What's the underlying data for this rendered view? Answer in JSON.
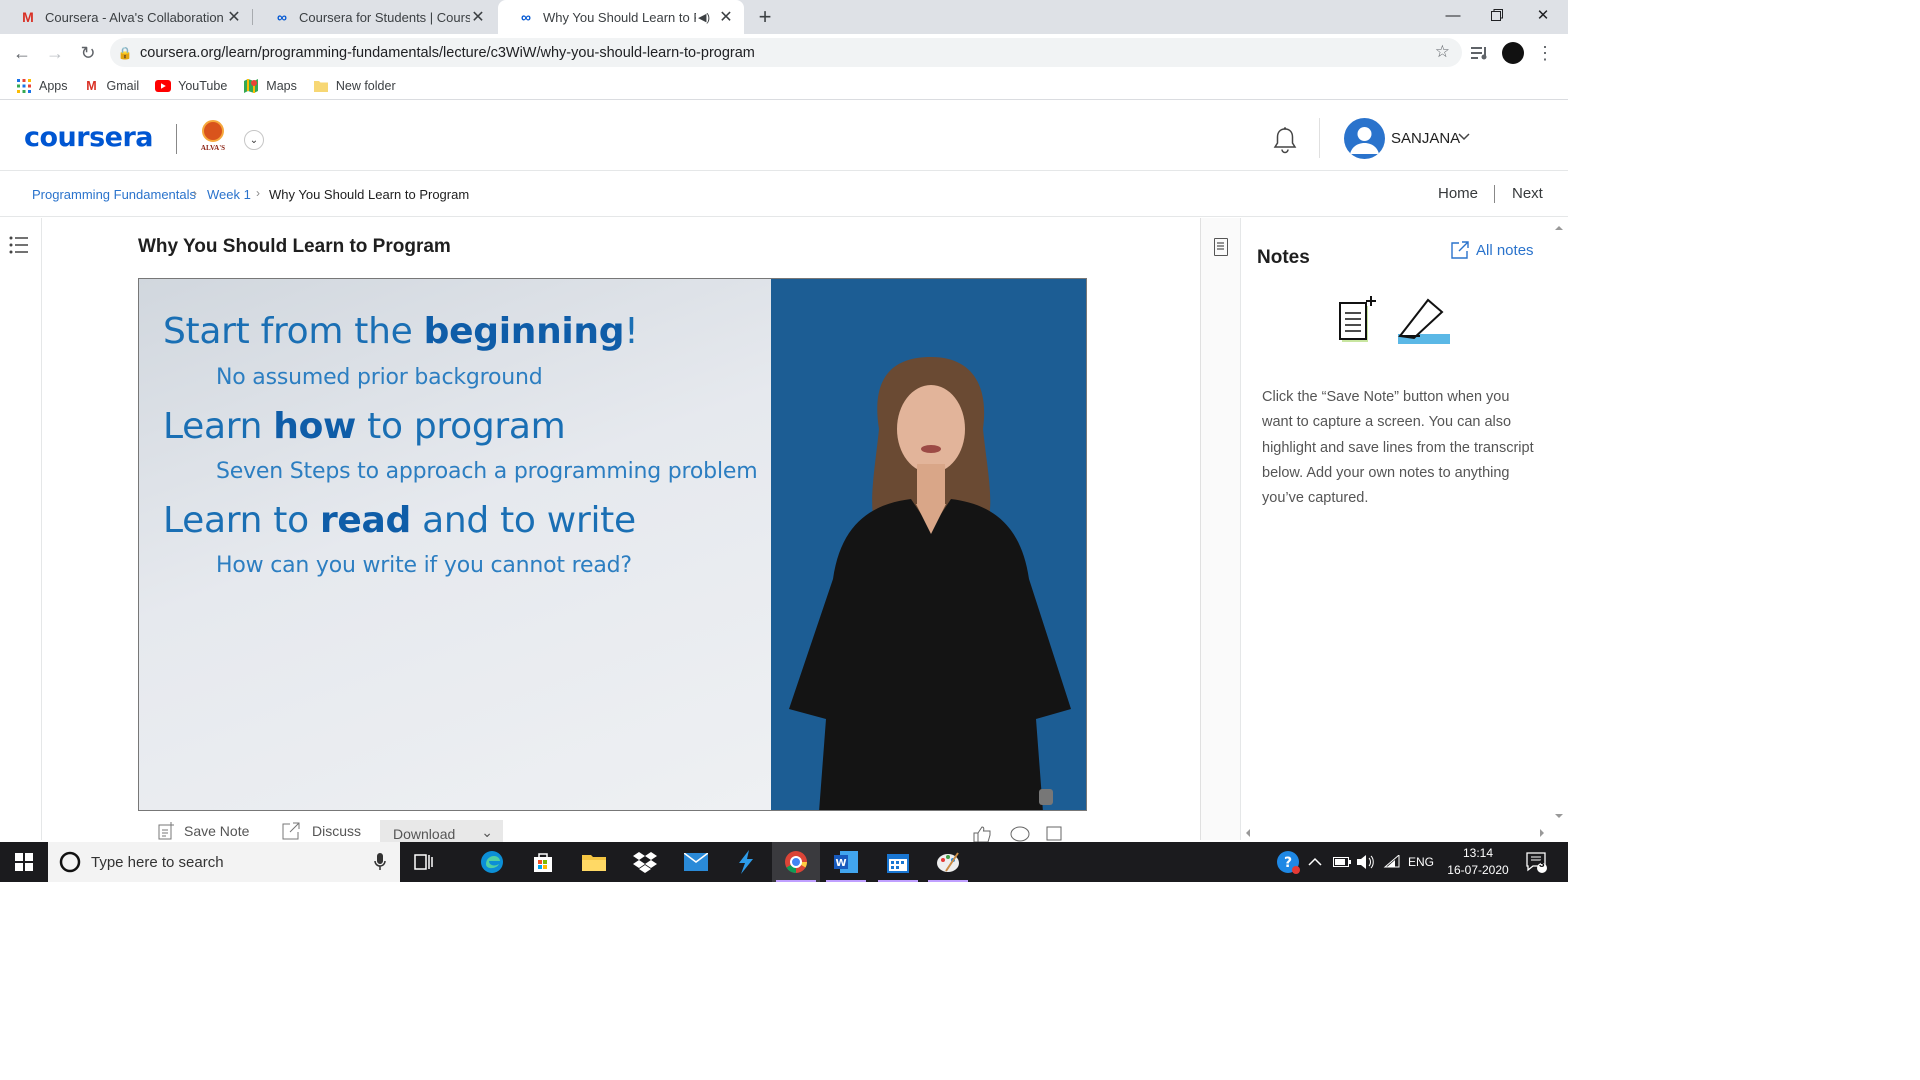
{
  "browser": {
    "tabs": [
      {
        "title": "Coursera - Alva's Collaboration - ",
        "icon": "gmail-icon",
        "active": false
      },
      {
        "title": "Coursera for Students | Coursera",
        "icon": "coursera-icon",
        "active": false
      },
      {
        "title": "Why You Should Learn to Pro",
        "icon": "coursera-icon",
        "active": true
      }
    ],
    "url": "coursera.org/learn/programming-fundamentals/lecture/c3WiW/why-you-should-learn-to-program",
    "bookmarks": [
      {
        "label": "Apps",
        "icon": "apps-grid-icon"
      },
      {
        "label": "Gmail",
        "icon": "gmail-icon"
      },
      {
        "label": "YouTube",
        "icon": "youtube-icon"
      },
      {
        "label": "Maps",
        "icon": "maps-icon"
      },
      {
        "label": "New folder",
        "icon": "folder-icon"
      }
    ]
  },
  "header": {
    "logo": "coursera",
    "org_label": "ALVA'S",
    "username": "SANJANA"
  },
  "breadcrumb": {
    "items": [
      "Programming Fundamentals",
      "Week 1",
      "Why You Should Learn to Program"
    ],
    "home": "Home",
    "next": "Next"
  },
  "lecture": {
    "title": "Why You Should Learn to Program",
    "slide": {
      "line1_pre": "Start from the ",
      "line1_bold": "beginning",
      "line1_post": "!",
      "sub1": "No assumed prior background",
      "line2_pre": "Learn ",
      "line2_bold": "how",
      "line2_post": " to program",
      "sub2": "Seven Steps to approach a programming problem",
      "line3_pre": "Learn to ",
      "line3_bold": "read",
      "line3_post": " and to write",
      "sub3": "How can you write if you cannot read?"
    },
    "controls": {
      "save_note": "Save Note",
      "discuss": "Discuss",
      "download": "Download"
    }
  },
  "notes": {
    "title": "Notes",
    "all_notes": "All notes",
    "description": "Click the “Save Note” button when you want to capture a screen. You can also highlight and save lines from the transcript below. Add your own notes to anything you’ve captured."
  },
  "taskbar": {
    "search_placeholder": "Type here to search",
    "language": "ENG",
    "time": "13:14",
    "date": "16-07-2020",
    "notification_count": "3"
  },
  "colors": {
    "brand": "#0056d2",
    "link": "#2a73cc",
    "slide_text": "#1a6fb4",
    "presenter_bg": "#1c5d94"
  }
}
